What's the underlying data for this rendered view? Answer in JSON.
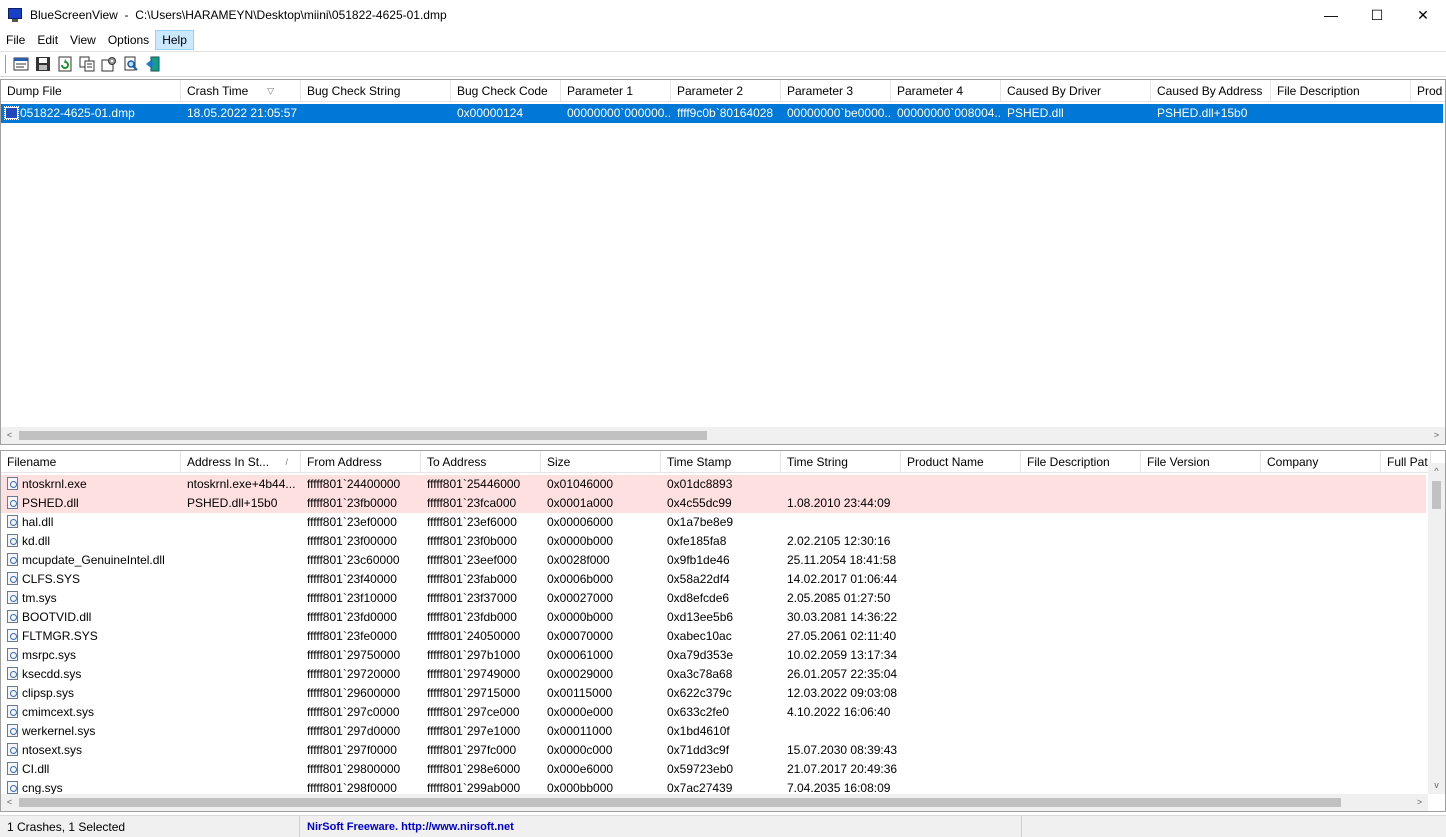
{
  "window": {
    "app_name": "BlueScreenView",
    "title_separator": "-",
    "file_path": "C:\\Users\\HARAMEYN\\Desktop\\miini\\051822-4625-01.dmp",
    "minimize_glyph": "—",
    "maximize_glyph": "☐",
    "close_glyph": "✕"
  },
  "menu": [
    "File",
    "Edit",
    "View",
    "Options",
    "Help"
  ],
  "toolbar": {
    "icons": [
      "properties-icon",
      "save-icon",
      "refresh-icon",
      "copy-icon",
      "advanced-options-icon",
      "find-icon",
      "exit-icon"
    ]
  },
  "crash_list": {
    "columns": [
      "Dump File",
      "Crash Time",
      "Bug Check String",
      "Bug Check Code",
      "Parameter 1",
      "Parameter 2",
      "Parameter 3",
      "Parameter 4",
      "Caused By Driver",
      "Caused By Address",
      "File Description",
      "Prod"
    ],
    "sort_glyph": "▽",
    "rows": [
      [
        "051822-4625-01.dmp",
        "18.05.2022 21:05:57",
        "",
        "0x00000124",
        "00000000`000000...",
        "ffff9c0b`80164028",
        "00000000`be0000...",
        "00000000`008004...",
        "PSHED.dll",
        "PSHED.dll+15b0",
        "",
        ""
      ]
    ]
  },
  "driver_list": {
    "columns": [
      "Filename",
      "Address In St...",
      "From Address",
      "To Address",
      "Size",
      "Time Stamp",
      "Time String",
      "Product Name",
      "File Description",
      "File Version",
      "Company",
      "Full Pat"
    ],
    "sort_glyph": "/",
    "rows": [
      [
        "ntoskrnl.exe",
        "ntoskrnl.exe+4b44...",
        "fffff801`24400000",
        "fffff801`25446000",
        "0x01046000",
        "0x01dc8893",
        ""
      ],
      [
        "PSHED.dll",
        "PSHED.dll+15b0",
        "fffff801`23fb0000",
        "fffff801`23fca000",
        "0x0001a000",
        "0x4c55dc99",
        "1.08.2010 23:44:09"
      ],
      [
        "hal.dll",
        "",
        "fffff801`23ef0000",
        "fffff801`23ef6000",
        "0x00006000",
        "0x1a7be8e9",
        ""
      ],
      [
        "kd.dll",
        "",
        "fffff801`23f00000",
        "fffff801`23f0b000",
        "0x0000b000",
        "0xfe185fa8",
        "2.02.2105 12:30:16"
      ],
      [
        "mcupdate_GenuineIntel.dll",
        "",
        "fffff801`23c60000",
        "fffff801`23eef000",
        "0x0028f000",
        "0x9fb1de46",
        "25.11.2054 18:41:58"
      ],
      [
        "CLFS.SYS",
        "",
        "fffff801`23f40000",
        "fffff801`23fab000",
        "0x0006b000",
        "0x58a22df4",
        "14.02.2017 01:06:44"
      ],
      [
        "tm.sys",
        "",
        "fffff801`23f10000",
        "fffff801`23f37000",
        "0x00027000",
        "0xd8efcde6",
        "2.05.2085 01:27:50"
      ],
      [
        "BOOTVID.dll",
        "",
        "fffff801`23fd0000",
        "fffff801`23fdb000",
        "0x0000b000",
        "0xd13ee5b6",
        "30.03.2081 14:36:22"
      ],
      [
        "FLTMGR.SYS",
        "",
        "fffff801`23fe0000",
        "fffff801`24050000",
        "0x00070000",
        "0xabec10ac",
        "27.05.2061 02:11:40"
      ],
      [
        "msrpc.sys",
        "",
        "fffff801`29750000",
        "fffff801`297b1000",
        "0x00061000",
        "0xa79d353e",
        "10.02.2059 13:17:34"
      ],
      [
        "ksecdd.sys",
        "",
        "fffff801`29720000",
        "fffff801`29749000",
        "0x00029000",
        "0xa3c78a68",
        "26.01.2057 22:35:04"
      ],
      [
        "clipsp.sys",
        "",
        "fffff801`29600000",
        "fffff801`29715000",
        "0x00115000",
        "0x622c379c",
        "12.03.2022 09:03:08"
      ],
      [
        "cmimcext.sys",
        "",
        "fffff801`297c0000",
        "fffff801`297ce000",
        "0x0000e000",
        "0x633c2fe0",
        "4.10.2022 16:06:40"
      ],
      [
        "werkernel.sys",
        "",
        "fffff801`297d0000",
        "fffff801`297e1000",
        "0x00011000",
        "0x1bd4610f",
        ""
      ],
      [
        "ntosext.sys",
        "",
        "fffff801`297f0000",
        "fffff801`297fc000",
        "0x0000c000",
        "0x71dd3c9f",
        "15.07.2030 08:39:43"
      ],
      [
        "CI.dll",
        "",
        "fffff801`29800000",
        "fffff801`298e6000",
        "0x000e6000",
        "0x59723eb0",
        "21.07.2017 20:49:36"
      ],
      [
        "cng.sys",
        "",
        "fffff801`298f0000",
        "fffff801`299ab000",
        "0x000bb000",
        "0x7ac27439",
        "7.04.2035 16:08:09"
      ]
    ],
    "highlight_rows": 2
  },
  "scroll": {
    "left_arrow": "<",
    "right_arrow": ">",
    "up_arrow": "^",
    "down_arrow": "v"
  },
  "status": {
    "summary": "1 Crashes, 1 Selected",
    "credit": "NirSoft Freeware.  http://www.nirsoft.net"
  }
}
